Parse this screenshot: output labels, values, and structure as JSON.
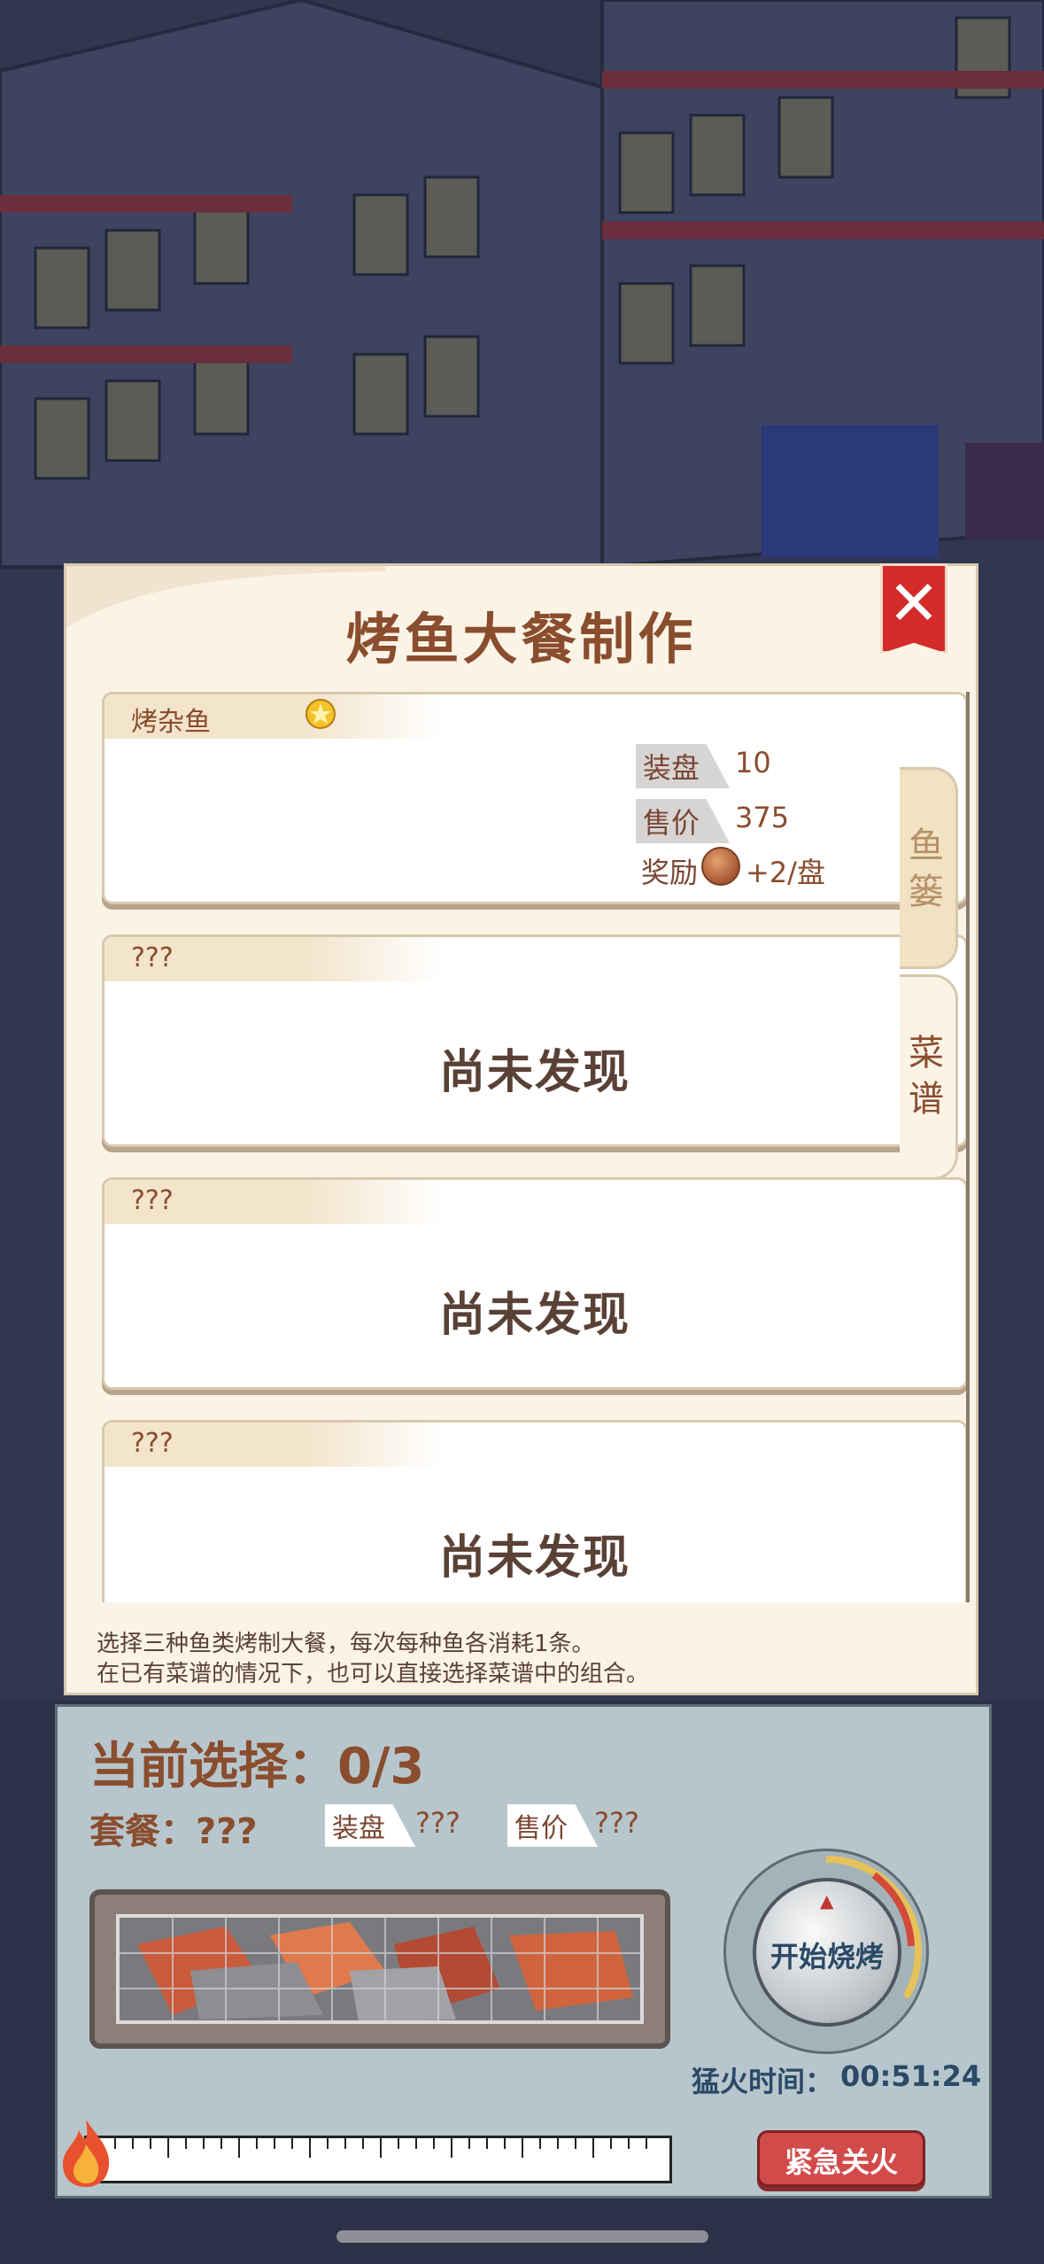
{
  "dialog": {
    "title": "烤鱼大餐制作",
    "tabs": [
      {
        "label": "鱼篓"
      },
      {
        "label": "菜谱"
      }
    ],
    "recipes": [
      {
        "name": "烤杂鱼",
        "plate_label": "装盘",
        "plate_value": "10",
        "price_label": "售价",
        "price_value": "375",
        "reward_label": "奖励",
        "reward_value": "+2/盘"
      },
      {
        "name": "???",
        "status": "尚未发现"
      },
      {
        "name": "???",
        "status": "尚未发现"
      },
      {
        "name": "???",
        "status": "尚未发现"
      }
    ],
    "hint_line1": "选择三种鱼类烤制大餐，每次每种鱼各消耗1条。",
    "hint_line2": "在已有菜谱的情况下，也可以直接选择菜谱中的组合。"
  },
  "panel": {
    "current_selection": "当前选择：0/3",
    "combo": "套餐：???",
    "plate_label": "装盘",
    "plate_value": "???",
    "price_label": "售价",
    "price_value": "???",
    "start_button": "开始烧烤",
    "fire_time_label": "猛火时间：",
    "fire_time_value": "00:51:24",
    "emergency_button": "紧急关火"
  },
  "colors": {
    "title_brown": "#8a4d2e",
    "close_red": "#d52a2a",
    "panel_blue": "#b7c6cc"
  }
}
